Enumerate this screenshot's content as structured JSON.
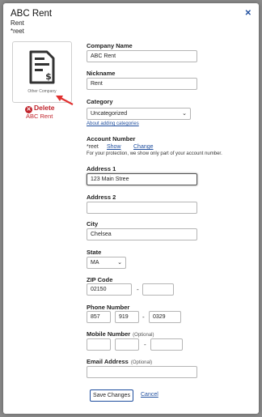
{
  "header": {
    "title": "ABC Rent",
    "subtitle": "Rent",
    "account_suffix": "*reet"
  },
  "logo": {
    "caption": "Other Company",
    "icon": "invoice-dollar-icon"
  },
  "delete": {
    "label": "Delete",
    "name": "ABC Rent",
    "color": "#c0232b"
  },
  "form": {
    "company_name": {
      "label": "Company Name",
      "value": "ABC Rent"
    },
    "nickname": {
      "label": "Nickname",
      "value": "Rent"
    },
    "category": {
      "label": "Category",
      "value": "Uncategorized",
      "link": "About adding categories"
    },
    "account_number": {
      "label": "Account Number",
      "value": "*reet",
      "show": "Show",
      "change": "Change",
      "note": "For your protection, we show only part of your account number."
    },
    "address1": {
      "label": "Address 1",
      "value": "123 Main Stree"
    },
    "address2": {
      "label": "Address 2",
      "value": ""
    },
    "city": {
      "label": "City",
      "value": "Chelsea"
    },
    "state": {
      "label": "State",
      "value": "MA"
    },
    "zip": {
      "label": "ZIP Code",
      "value": "02150",
      "ext": ""
    },
    "phone": {
      "label": "Phone Number",
      "area": "857",
      "prefix": "919",
      "line": "0329"
    },
    "mobile": {
      "label": "Mobile Number",
      "optional": "(Optional)",
      "area": "",
      "prefix": "",
      "line": ""
    },
    "email": {
      "label": "Email Address",
      "optional": "(Optional)",
      "value": ""
    }
  },
  "actions": {
    "save": "Save Changes",
    "cancel": "Cancel"
  },
  "colors": {
    "link": "#1f4e9e",
    "delete": "#c0232b"
  }
}
